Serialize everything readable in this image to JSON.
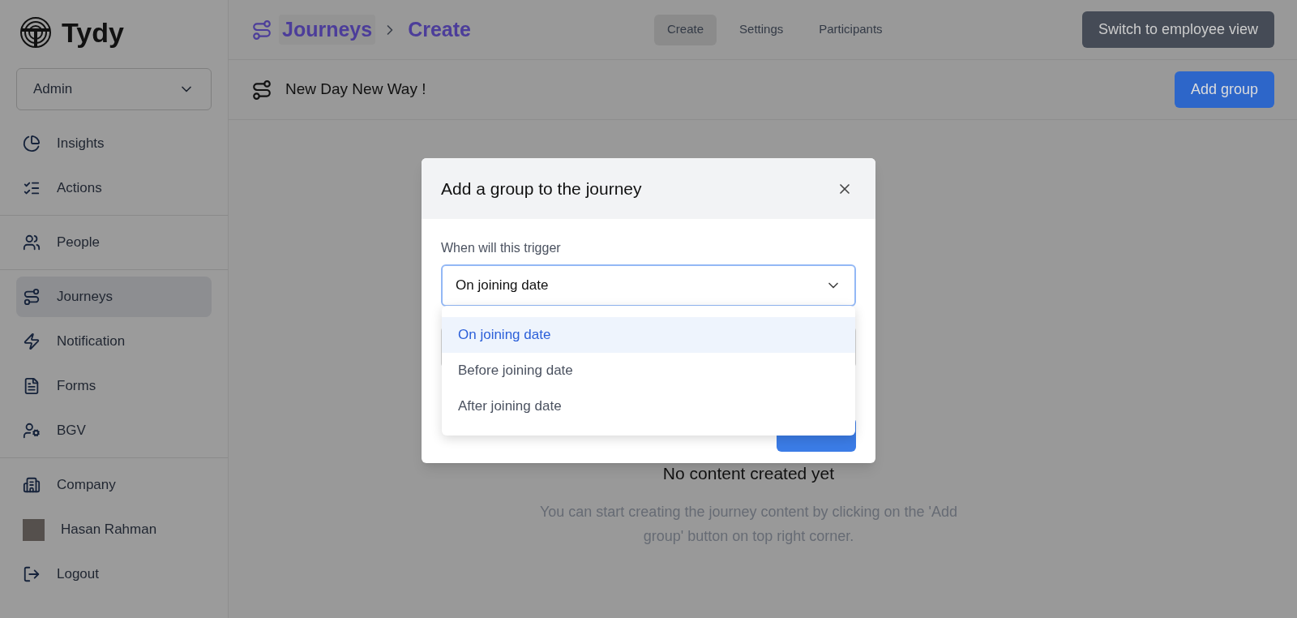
{
  "brand": "Tydy",
  "role_select": {
    "value": "Admin"
  },
  "sidebar": {
    "groups": [
      [
        {
          "label": "Insights",
          "selected": false
        },
        {
          "label": "Actions",
          "selected": false
        }
      ],
      [
        {
          "label": "People",
          "selected": false
        }
      ],
      [
        {
          "label": "Journeys",
          "selected": true
        },
        {
          "label": "Notification",
          "selected": false
        },
        {
          "label": "Forms",
          "selected": false
        },
        {
          "label": "BGV",
          "selected": false
        }
      ],
      [
        {
          "label": "Company",
          "selected": false,
          "kind": "icon"
        },
        {
          "label": "Hasan Rahman",
          "selected": false,
          "kind": "avatar"
        },
        {
          "label": "Logout",
          "selected": false,
          "kind": "icon"
        }
      ]
    ]
  },
  "breadcrumb": [
    "Journeys",
    "Create"
  ],
  "tabs": [
    {
      "label": "Create",
      "selected": true
    },
    {
      "label": "Settings",
      "selected": false
    },
    {
      "label": "Participants",
      "selected": false
    }
  ],
  "switch_button": "Switch to employee view",
  "journey_title": "New Day New Way !",
  "add_group_button": "Add group",
  "empty_state": {
    "title": "No content created yet",
    "text": "You can start creating the journey content by clicking on the 'Add group' button on top right corner."
  },
  "modal": {
    "title": "Add a group to the journey",
    "field_label": "When will this trigger",
    "select_value": "On joining date",
    "options": [
      {
        "label": "On joining date",
        "selected": true
      },
      {
        "label": "Before joining date",
        "selected": false
      },
      {
        "label": "After joining date",
        "selected": false
      }
    ]
  }
}
